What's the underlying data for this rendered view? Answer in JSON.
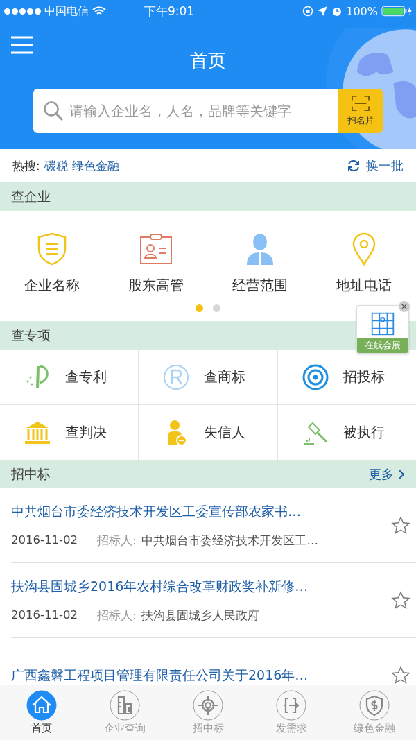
{
  "status_bar": {
    "carrier": "中国电信",
    "time": "下午9:01",
    "battery": "100%"
  },
  "header": {
    "title": "首页"
  },
  "search": {
    "placeholder": "请输入企业名，人名，品牌等关键字",
    "scan_label": "扫名片"
  },
  "hot_search": {
    "label": "热搜:",
    "terms": [
      "碳税",
      "绿色金融"
    ],
    "refresh": "换一批"
  },
  "company_section": {
    "title": "查企业",
    "items": [
      "企业名称",
      "股东高管",
      "经营范围",
      "地址电话"
    ],
    "page_dots": [
      {
        "selected": true
      },
      {
        "selected": false
      }
    ]
  },
  "floating_badge": {
    "label": "在线会展",
    "close": "×"
  },
  "special_section": {
    "title": "查专项",
    "items": [
      "查专利",
      "查商标",
      "招投标",
      "查判决",
      "失信人",
      "被执行"
    ]
  },
  "tender_section": {
    "title": "招中标",
    "more": "更多",
    "rows": [
      {
        "title": "中共烟台市委经济技术开发区工委宣传部农家书…",
        "date": "2016-11-02",
        "tenderer_label": "招标人:",
        "tenderer": "中共烟台市委经济技术开发区工…",
        "starred": false
      },
      {
        "title": "扶沟县固城乡2016年农村综合改革财政奖补新修…",
        "date": "2016-11-02",
        "tenderer_label": "招标人:",
        "tenderer": "扶沟县固城乡人民政府",
        "starred": false
      },
      {
        "title": "广西鑫磐工程项目管理有限责任公司关于2016年…",
        "starred": false
      }
    ]
  },
  "tab_bar": [
    {
      "label": "首页",
      "selected": true
    },
    {
      "label": "企业查询",
      "selected": false
    },
    {
      "label": "招中标",
      "selected": false
    },
    {
      "label": "发需求",
      "selected": false
    },
    {
      "label": "绿色金融",
      "selected": false
    }
  ]
}
